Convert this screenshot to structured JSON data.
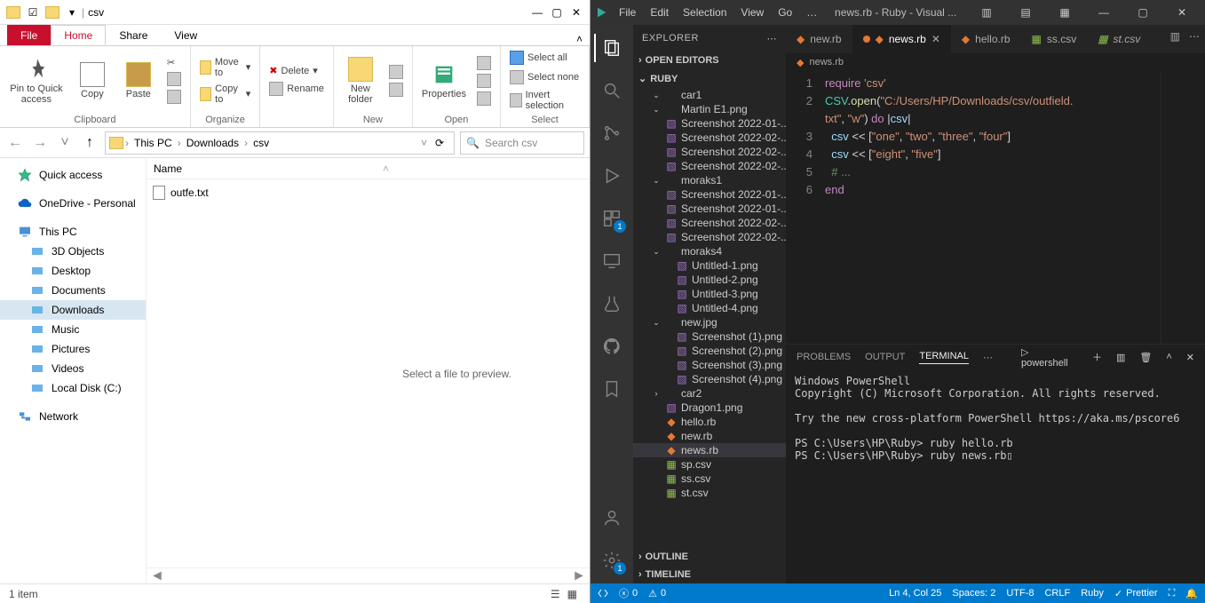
{
  "fe": {
    "title": "csv",
    "tabs": {
      "file": "File",
      "home": "Home",
      "share": "Share",
      "view": "View"
    },
    "ribbon": {
      "clipboard": {
        "label": "Clipboard",
        "pin": "Pin to Quick access",
        "copy": "Copy",
        "paste": "Paste"
      },
      "organize": {
        "label": "Organize",
        "moveto": "Move to",
        "copyto": "Copy to",
        "delete": "Delete",
        "rename": "Rename"
      },
      "new": {
        "label": "New",
        "newfolder": "New folder"
      },
      "open": {
        "label": "Open",
        "properties": "Properties"
      },
      "select": {
        "label": "Select",
        "all": "Select all",
        "none": "Select none",
        "invert": "Invert selection"
      }
    },
    "breadcrumbs": [
      "This PC",
      "Downloads",
      "csv"
    ],
    "search_placeholder": "Search csv",
    "side": [
      {
        "label": "Quick access",
        "kind": "star"
      },
      {
        "label": "OneDrive - Personal",
        "kind": "cloud"
      },
      {
        "label": "This PC",
        "kind": "pc"
      },
      {
        "label": "3D Objects",
        "kind": "sub"
      },
      {
        "label": "Desktop",
        "kind": "sub"
      },
      {
        "label": "Documents",
        "kind": "sub"
      },
      {
        "label": "Downloads",
        "kind": "sub",
        "selected": true
      },
      {
        "label": "Music",
        "kind": "sub"
      },
      {
        "label": "Pictures",
        "kind": "sub"
      },
      {
        "label": "Videos",
        "kind": "sub"
      },
      {
        "label": "Local Disk (C:)",
        "kind": "sub"
      },
      {
        "label": "Network",
        "kind": "net"
      }
    ],
    "col_name": "Name",
    "files": [
      {
        "label": "outfe.txt"
      }
    ],
    "preview": "Select a file to preview.",
    "status": "1 item"
  },
  "vsc": {
    "title": "news.rb - Ruby - Visual ...",
    "menu": [
      "File",
      "Edit",
      "Selection",
      "View",
      "Go",
      "…"
    ],
    "explorer_title": "EXPLORER",
    "sections": {
      "open": "OPEN EDITORS",
      "ruby": "RUBY",
      "outline": "OUTLINE",
      "timeline": "TIMELINE"
    },
    "tree": [
      {
        "d": 1,
        "t": "folder",
        "open": true,
        "label": "car1"
      },
      {
        "d": 1,
        "t": "folder",
        "open": true,
        "label": "Martin E1.png"
      },
      {
        "d": 2,
        "t": "img",
        "label": "Screenshot 2022-01-..."
      },
      {
        "d": 2,
        "t": "img",
        "label": "Screenshot 2022-02-..."
      },
      {
        "d": 2,
        "t": "img",
        "label": "Screenshot 2022-02-..."
      },
      {
        "d": 2,
        "t": "img",
        "label": "Screenshot 2022-02-..."
      },
      {
        "d": 1,
        "t": "folder",
        "open": true,
        "label": "moraks1"
      },
      {
        "d": 2,
        "t": "img",
        "label": "Screenshot 2022-01-..."
      },
      {
        "d": 2,
        "t": "img",
        "label": "Screenshot 2022-01-..."
      },
      {
        "d": 2,
        "t": "img",
        "label": "Screenshot 2022-02-..."
      },
      {
        "d": 2,
        "t": "img",
        "label": "Screenshot 2022-02-..."
      },
      {
        "d": 1,
        "t": "folder",
        "open": true,
        "label": "moraks4"
      },
      {
        "d": 2,
        "t": "img",
        "label": "Untitled-1.png"
      },
      {
        "d": 2,
        "t": "img",
        "label": "Untitled-2.png"
      },
      {
        "d": 2,
        "t": "img",
        "label": "Untitled-3.png"
      },
      {
        "d": 2,
        "t": "img",
        "label": "Untitled-4.png"
      },
      {
        "d": 1,
        "t": "folder",
        "open": true,
        "label": "new.jpg"
      },
      {
        "d": 2,
        "t": "img",
        "label": "Screenshot (1).png"
      },
      {
        "d": 2,
        "t": "img",
        "label": "Screenshot (2).png"
      },
      {
        "d": 2,
        "t": "img",
        "label": "Screenshot (3).png"
      },
      {
        "d": 2,
        "t": "img",
        "label": "Screenshot (4).png"
      },
      {
        "d": 1,
        "t": "folder",
        "open": false,
        "label": "car2"
      },
      {
        "d": 1,
        "t": "img",
        "label": "Dragon1.png"
      },
      {
        "d": 1,
        "t": "rb",
        "label": "hello.rb"
      },
      {
        "d": 1,
        "t": "rb",
        "label": "new.rb"
      },
      {
        "d": 1,
        "t": "rb",
        "label": "news.rb",
        "selected": true
      },
      {
        "d": 1,
        "t": "csv",
        "label": "sp.csv"
      },
      {
        "d": 1,
        "t": "csv",
        "label": "ss.csv"
      },
      {
        "d": 1,
        "t": "csv",
        "label": "st.csv"
      }
    ],
    "tabs": [
      {
        "label": "new.rb",
        "icon": "rb"
      },
      {
        "label": "news.rb",
        "icon": "rb",
        "active": true,
        "mod": true
      },
      {
        "label": "hello.rb",
        "icon": "rb"
      },
      {
        "label": "ss.csv",
        "icon": "csv"
      },
      {
        "label": "st.csv",
        "icon": "csv",
        "italic": true
      }
    ],
    "breadcrumb": "news.rb",
    "code_lines": [
      {
        "n": "1",
        "html": "<span class='tok-k'>require</span> <span class='tok-s'>'csv'</span>"
      },
      {
        "n": "2",
        "html": "<span class='tok-c'>CSV</span>.<span class='tok-f'>open</span>(<span class='tok-s'>\"C:/Users/HP/Downloads/csv/outfield.</span>"
      },
      {
        "n": "",
        "html": "<span class='tok-s'>txt\"</span>, <span class='tok-s'>\"w\"</span>) <span class='tok-k'>do</span> |<span class='tok-v'>csv</span>|"
      },
      {
        "n": "3",
        "html": "  <span class='tok-v'>csv</span> &lt;&lt; [<span class='tok-s'>\"one\"</span>, <span class='tok-s'>\"two\"</span>, <span class='tok-s'>\"three\"</span>, <span class='tok-s'>\"four\"</span>]"
      },
      {
        "n": "4",
        "html": "  <span class='tok-v'>csv</span> &lt;&lt; [<span class='tok-s'>\"eight\"</span>, <span class='tok-s'>\"five\"</span>]"
      },
      {
        "n": "5",
        "html": "  <span class='tok-cm'># ...</span>"
      },
      {
        "n": "6",
        "html": "<span class='tok-k'>end</span>"
      }
    ],
    "panel": {
      "tabs": {
        "problems": "PROBLEMS",
        "output": "OUTPUT",
        "terminal": "TERMINAL"
      },
      "shell": "powershell",
      "text": "Windows PowerShell\nCopyright (C) Microsoft Corporation. All rights reserved.\n\nTry the new cross-platform PowerShell https://aka.ms/pscore6\n\nPS C:\\Users\\HP\\Ruby> ruby hello.rb\nPS C:\\Users\\HP\\Ruby> ruby news.rb▯"
    },
    "status": {
      "errors": "0",
      "warnings": "0",
      "pos": "Ln 4, Col 25",
      "spaces": "Spaces: 2",
      "enc": "UTF-8",
      "eol": "CRLF",
      "lang": "Ruby",
      "prettier": "Prettier"
    },
    "badges": {
      "scm": "1",
      "ext": "1"
    }
  }
}
